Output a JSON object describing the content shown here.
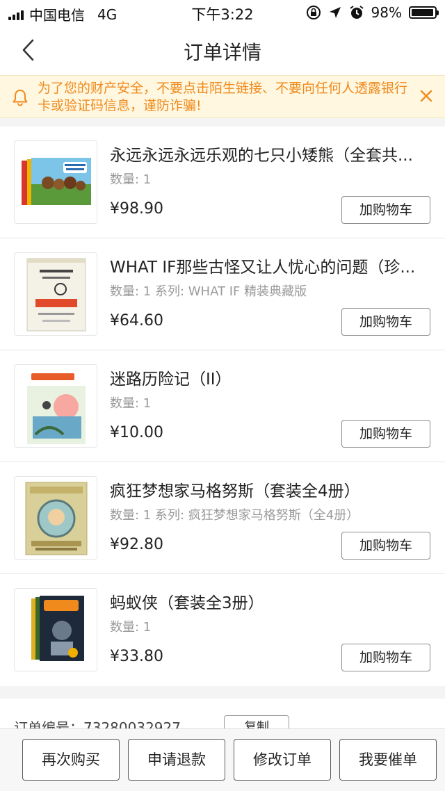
{
  "status_bar": {
    "carrier": "中国电信",
    "network": "4G",
    "time": "下午3:22",
    "battery": "98%",
    "battery_level": 0.98
  },
  "nav": {
    "title": "订单详情"
  },
  "notice": {
    "text": "为了您的财产安全，不要点击陌生链接、不要向任何人透露银行卡或验证码信息，谨防诈骗!",
    "accent_color": "#f08a1c"
  },
  "items": [
    {
      "title": "永远永远永远乐观的七只小矮熊（全套共...",
      "meta": "数量: 1",
      "price": "¥98.90",
      "button": "加购物车"
    },
    {
      "title": "WHAT IF那些古怪又让人忧心的问题（珍...",
      "meta": "数量: 1 系列: WHAT IF 精装典藏版",
      "price": "¥64.60",
      "button": "加购物车"
    },
    {
      "title": "迷路历险记（II）",
      "meta": "数量: 1",
      "price": "¥10.00",
      "button": "加购物车"
    },
    {
      "title": "疯狂梦想家马格努斯（套装全4册）",
      "meta": "数量: 1 系列: 疯狂梦想家马格努斯（全4册）",
      "price": "¥92.80",
      "button": "加购物车"
    },
    {
      "title": "蚂蚁侠（套装全3册）",
      "meta": "数量: 1",
      "price": "¥33.80",
      "button": "加购物车"
    }
  ],
  "order": {
    "label": "订单编号：73280032927",
    "copy": "复制"
  },
  "bottom_bar": {
    "buy_again": "再次购买",
    "refund": "申请退款",
    "modify": "修改订单",
    "urge": "我要催单"
  }
}
